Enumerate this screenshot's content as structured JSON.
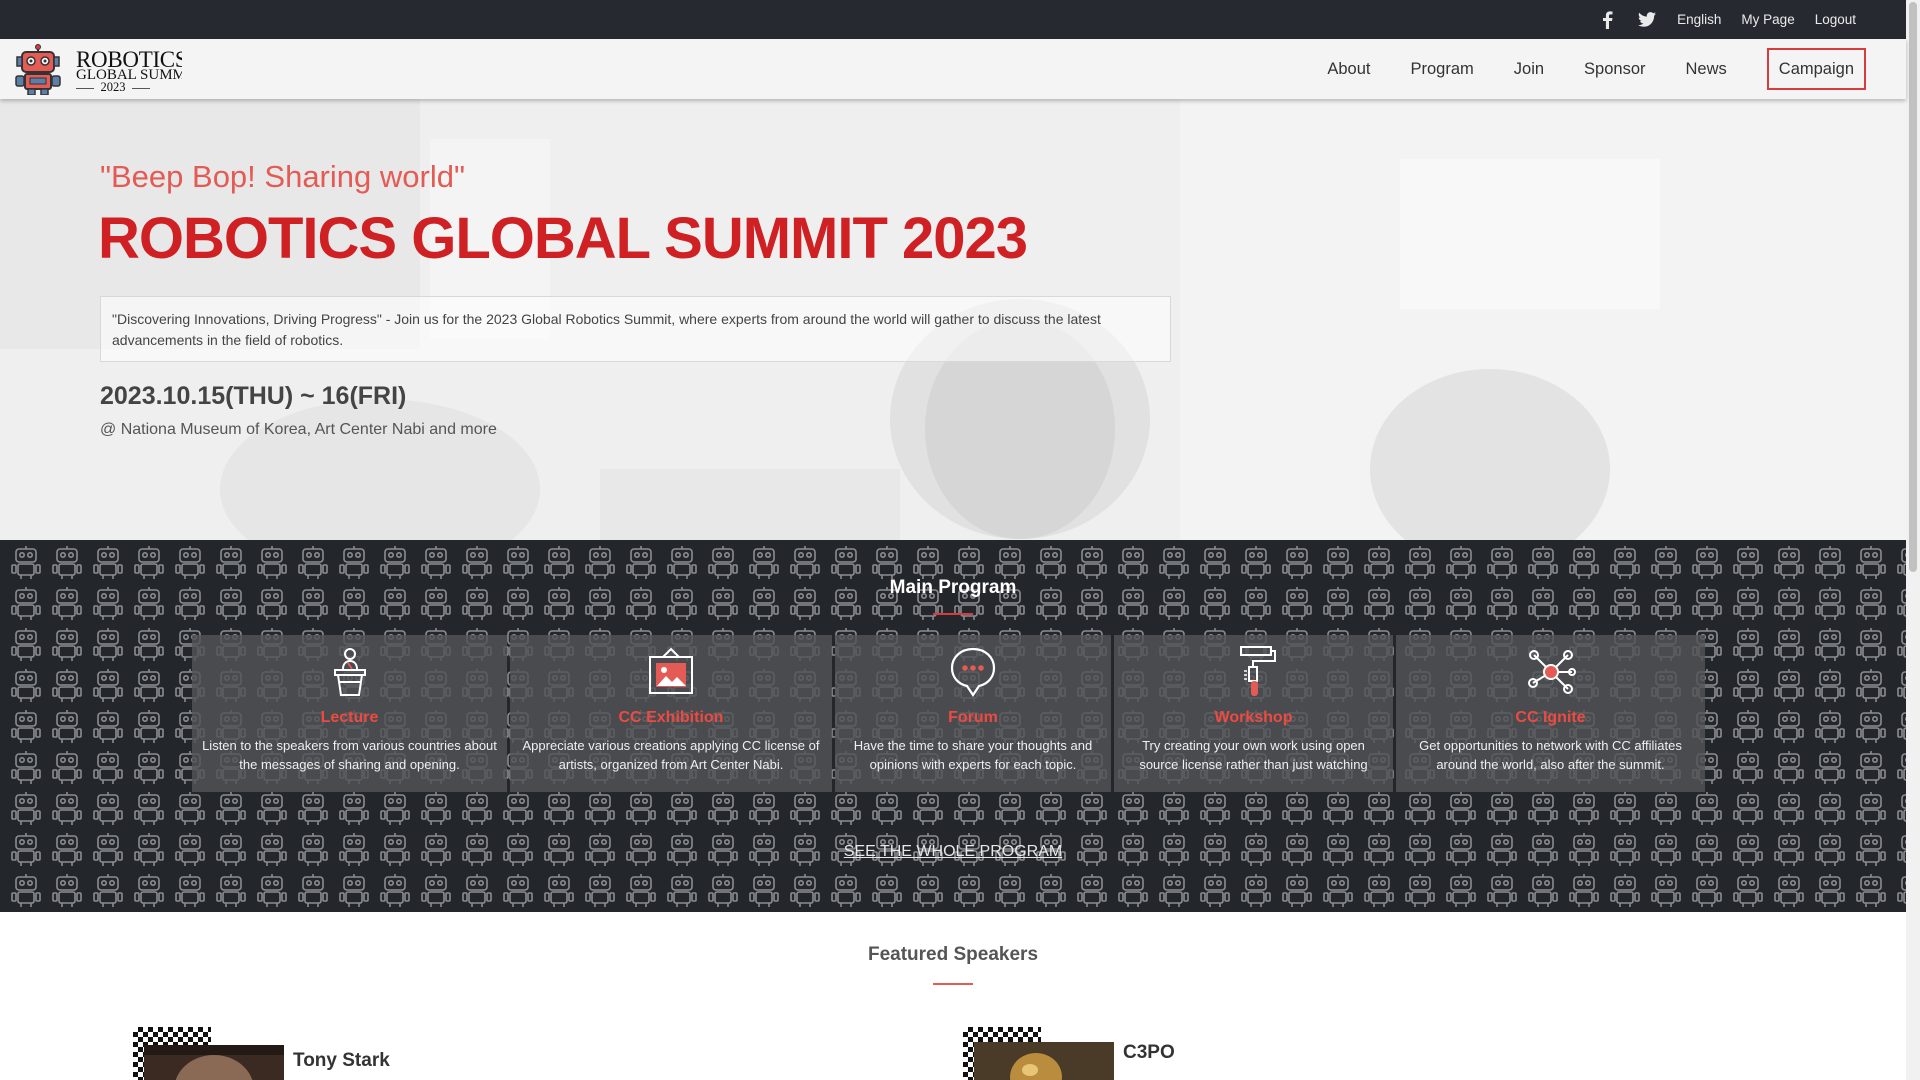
{
  "topbar": {
    "social": [
      {
        "name": "facebook",
        "glyph": "f"
      },
      {
        "name": "twitter",
        "glyph": "t"
      }
    ],
    "links": [
      "English",
      "My Page",
      "Logout"
    ]
  },
  "header": {
    "logo": {
      "line1": "ROBOTICS",
      "line2": "GLOBAL SUMMIT",
      "line3": "2023"
    },
    "nav": [
      "About",
      "Program",
      "Join",
      "Sponsor",
      "News"
    ],
    "campaign": "Campaign"
  },
  "hero": {
    "tagline": "\"Beep Bop! Sharing world\"",
    "title": "ROBOTICS GLOBAL SUMMIT 2023",
    "description": "\"Discovering Innovations, Driving Progress\" - Join us for the 2023 Global Robotics Summit, where experts from around the world will gather to discuss the latest advancements in the field of robotics.",
    "date": "2023.10.15(THU) ~ 16(FRI)",
    "venue": "@ Nationa Museum of Korea, Art Center Nabi and more"
  },
  "program": {
    "title": "Main Program",
    "cards": [
      {
        "icon": "lecture-podium-icon",
        "title": "Lecture",
        "text": "Listen to the speakers from various countries about the messages of sharing and opening."
      },
      {
        "icon": "exhibition-picture-icon",
        "title": "CC Exhibition",
        "text": "Appreciate various creations applying CC license of artists, organized from Art Center Nabi."
      },
      {
        "icon": "forum-chat-icon",
        "title": "Forum",
        "text": "Have the time to share your thoughts and opinions with experts for each topic."
      },
      {
        "icon": "workshop-paint-roller-icon",
        "title": "Workshop",
        "text": "Try creating your own work using open source license rather than just watching"
      },
      {
        "icon": "network-nodes-icon",
        "title": "CC Ignite",
        "text": "Get opportunities to network with CC affiliates around the world, also after the summit."
      }
    ],
    "see_whole": "SEE THE WHOLE PROGRAM"
  },
  "speakers": {
    "title": "Featured Speakers",
    "items": [
      {
        "name": "Tony Stark"
      },
      {
        "name": "C3PO"
      }
    ]
  },
  "colors": {
    "accent": "#d83a3e",
    "title_red": "#cf2024",
    "tagline_red": "#e35b54",
    "topbar": "#262a30",
    "program_bg": "#23262b"
  }
}
